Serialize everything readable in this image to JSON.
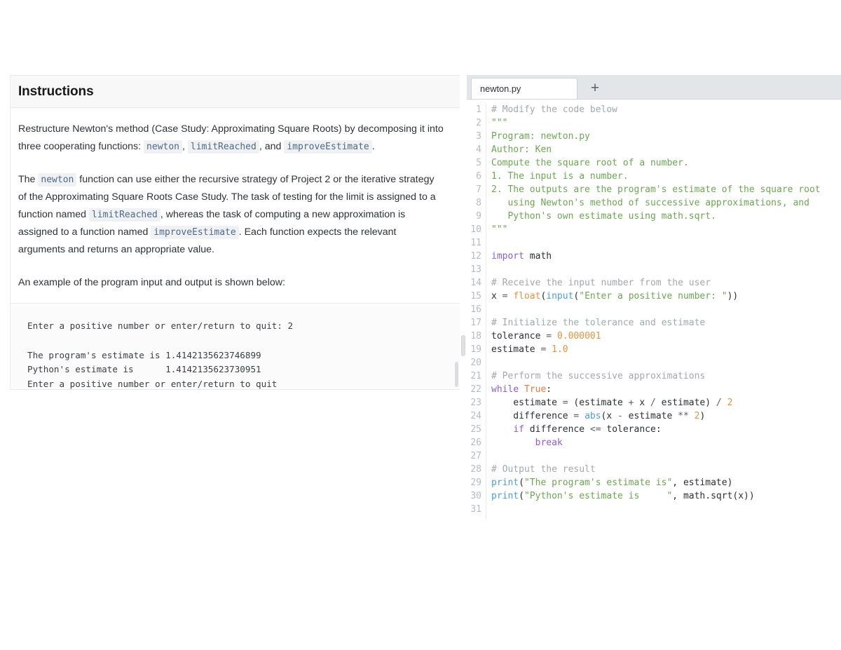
{
  "instructions": {
    "title": "Instructions",
    "paragraphs": [
      {
        "id": "p1",
        "parts": [
          {
            "t": "text",
            "v": "Restructure Newton's method (Case Study: Approximating Square Roots) by decomposing it into three cooperating functions: "
          },
          {
            "t": "code",
            "v": "newton"
          },
          {
            "t": "text",
            "v": ", "
          },
          {
            "t": "code",
            "v": "limitReached"
          },
          {
            "t": "text",
            "v": ", and "
          },
          {
            "t": "code",
            "v": "improveEstimate"
          },
          {
            "t": "text",
            "v": "."
          }
        ]
      },
      {
        "id": "p2",
        "parts": [
          {
            "t": "text",
            "v": "The "
          },
          {
            "t": "code",
            "v": "newton"
          },
          {
            "t": "text",
            "v": " function can use either the recursive strategy of Project 2 or the iterative strategy of the Approximating Square Roots Case Study. The task of testing for the limit is assigned to a function named "
          },
          {
            "t": "code",
            "v": "limitReached"
          },
          {
            "t": "text",
            "v": ", whereas the task of computing a new approximation is assigned to a function named "
          },
          {
            "t": "code",
            "v": "improveEstimate"
          },
          {
            "t": "text",
            "v": ". Each function expects the relevant arguments and returns an appropriate value."
          }
        ]
      },
      {
        "id": "p3",
        "parts": [
          {
            "t": "text",
            "v": "An example of the program input and output is shown below:"
          }
        ]
      }
    ],
    "example_output": "Enter a positive number or enter/return to quit: 2\n\nThe program's estimate is 1.4142135623746899\nPython's estimate is      1.4142135623730951\nEnter a positive number or enter/return to quit"
  },
  "editor": {
    "tabs": [
      {
        "label": "newton.py",
        "active": true
      }
    ],
    "new_tab_label": "+",
    "new_tab_icon": "plus-icon",
    "first_line_number": 1,
    "total_lines": 31,
    "lines": [
      {
        "n": 1,
        "tokens": [
          {
            "c": "comment",
            "v": "# Modify the code below"
          }
        ]
      },
      {
        "n": 2,
        "tokens": [
          {
            "c": "doc",
            "v": "\"\"\""
          }
        ]
      },
      {
        "n": 3,
        "tokens": [
          {
            "c": "doc",
            "v": "Program: newton.py"
          }
        ]
      },
      {
        "n": 4,
        "tokens": [
          {
            "c": "doc",
            "v": "Author: Ken"
          }
        ]
      },
      {
        "n": 5,
        "tokens": [
          {
            "c": "doc",
            "v": "Compute the square root of a number."
          }
        ]
      },
      {
        "n": 6,
        "tokens": [
          {
            "c": "doc",
            "v": "1. The input is a number."
          }
        ]
      },
      {
        "n": 7,
        "tokens": [
          {
            "c": "doc",
            "v": "2. The outputs are the program's estimate of the square root"
          }
        ]
      },
      {
        "n": 8,
        "tokens": [
          {
            "c": "doc",
            "v": "   using Newton's method of successive approximations, and"
          }
        ]
      },
      {
        "n": 9,
        "tokens": [
          {
            "c": "doc",
            "v": "   Python's own estimate using math.sqrt."
          }
        ]
      },
      {
        "n": 10,
        "tokens": [
          {
            "c": "doc",
            "v": "\"\"\""
          }
        ]
      },
      {
        "n": 11,
        "tokens": []
      },
      {
        "n": 12,
        "tokens": [
          {
            "c": "kw",
            "v": "import"
          },
          {
            "c": "plain",
            "v": " math"
          }
        ]
      },
      {
        "n": 13,
        "tokens": []
      },
      {
        "n": 14,
        "tokens": [
          {
            "c": "comment",
            "v": "# Receive the input number from the user"
          }
        ]
      },
      {
        "n": 15,
        "tokens": [
          {
            "c": "plain",
            "v": "x "
          },
          {
            "c": "op",
            "v": "="
          },
          {
            "c": "plain",
            "v": " "
          },
          {
            "c": "fn",
            "v": "float"
          },
          {
            "c": "plain",
            "v": "("
          },
          {
            "c": "builtin",
            "v": "input"
          },
          {
            "c": "plain",
            "v": "("
          },
          {
            "c": "str",
            "v": "\"Enter a positive number: \""
          },
          {
            "c": "plain",
            "v": "))"
          }
        ]
      },
      {
        "n": 16,
        "tokens": []
      },
      {
        "n": 17,
        "tokens": [
          {
            "c": "comment",
            "v": "# Initialize the tolerance and estimate"
          }
        ]
      },
      {
        "n": 18,
        "tokens": [
          {
            "c": "plain",
            "v": "tolerance "
          },
          {
            "c": "op",
            "v": "="
          },
          {
            "c": "plain",
            "v": " "
          },
          {
            "c": "num",
            "v": "0.000001"
          }
        ]
      },
      {
        "n": 19,
        "tokens": [
          {
            "c": "plain",
            "v": "estimate "
          },
          {
            "c": "op",
            "v": "="
          },
          {
            "c": "plain",
            "v": " "
          },
          {
            "c": "num",
            "v": "1.0"
          }
        ]
      },
      {
        "n": 20,
        "tokens": []
      },
      {
        "n": 21,
        "tokens": [
          {
            "c": "comment",
            "v": "# Perform the successive approximations"
          }
        ]
      },
      {
        "n": 22,
        "tokens": [
          {
            "c": "kw",
            "v": "while"
          },
          {
            "c": "plain",
            "v": " "
          },
          {
            "c": "const",
            "v": "True"
          },
          {
            "c": "plain",
            "v": ":"
          }
        ]
      },
      {
        "n": 23,
        "tokens": [
          {
            "c": "plain",
            "v": "    estimate "
          },
          {
            "c": "op",
            "v": "="
          },
          {
            "c": "plain",
            "v": " (estimate "
          },
          {
            "c": "op",
            "v": "+"
          },
          {
            "c": "plain",
            "v": " x "
          },
          {
            "c": "op",
            "v": "/"
          },
          {
            "c": "plain",
            "v": " estimate) "
          },
          {
            "c": "op",
            "v": "/"
          },
          {
            "c": "plain",
            "v": " "
          },
          {
            "c": "num",
            "v": "2"
          }
        ]
      },
      {
        "n": 24,
        "tokens": [
          {
            "c": "plain",
            "v": "    difference "
          },
          {
            "c": "op",
            "v": "="
          },
          {
            "c": "plain",
            "v": " "
          },
          {
            "c": "builtin",
            "v": "abs"
          },
          {
            "c": "plain",
            "v": "(x "
          },
          {
            "c": "op",
            "v": "-"
          },
          {
            "c": "plain",
            "v": " estimate "
          },
          {
            "c": "op",
            "v": "**"
          },
          {
            "c": "plain",
            "v": " "
          },
          {
            "c": "num",
            "v": "2"
          },
          {
            "c": "plain",
            "v": ")"
          }
        ]
      },
      {
        "n": 25,
        "tokens": [
          {
            "c": "plain",
            "v": "    "
          },
          {
            "c": "kw",
            "v": "if"
          },
          {
            "c": "plain",
            "v": " difference "
          },
          {
            "c": "op",
            "v": "<="
          },
          {
            "c": "plain",
            "v": " tolerance:"
          }
        ]
      },
      {
        "n": 26,
        "tokens": [
          {
            "c": "plain",
            "v": "        "
          },
          {
            "c": "kw",
            "v": "break"
          }
        ]
      },
      {
        "n": 27,
        "tokens": []
      },
      {
        "n": 28,
        "tokens": [
          {
            "c": "comment",
            "v": "# Output the result"
          }
        ]
      },
      {
        "n": 29,
        "tokens": [
          {
            "c": "builtin",
            "v": "print"
          },
          {
            "c": "plain",
            "v": "("
          },
          {
            "c": "str",
            "v": "\"The program's estimate is\""
          },
          {
            "c": "plain",
            "v": ", estimate)"
          }
        ]
      },
      {
        "n": 30,
        "tokens": [
          {
            "c": "builtin",
            "v": "print"
          },
          {
            "c": "plain",
            "v": "("
          },
          {
            "c": "str",
            "v": "\"Python's estimate is     \""
          },
          {
            "c": "plain",
            "v": ", math.sqrt(x))"
          }
        ]
      },
      {
        "n": 31,
        "tokens": []
      }
    ]
  },
  "colors": {
    "comment": "#a3a8ad",
    "docstring": "#6aa84f",
    "keyword": "#8e5cd9",
    "builtin": "#4a9fe0",
    "function": "#e8913a",
    "string": "#6aa84f",
    "number": "#e8913a",
    "constant": "#f07a3c",
    "tabbar_bg": "#e3e6e8",
    "header_bg": "#f8f8f8",
    "inline_code_text": "#4b6a8c",
    "inline_code_bg": "#f0f1f2"
  }
}
